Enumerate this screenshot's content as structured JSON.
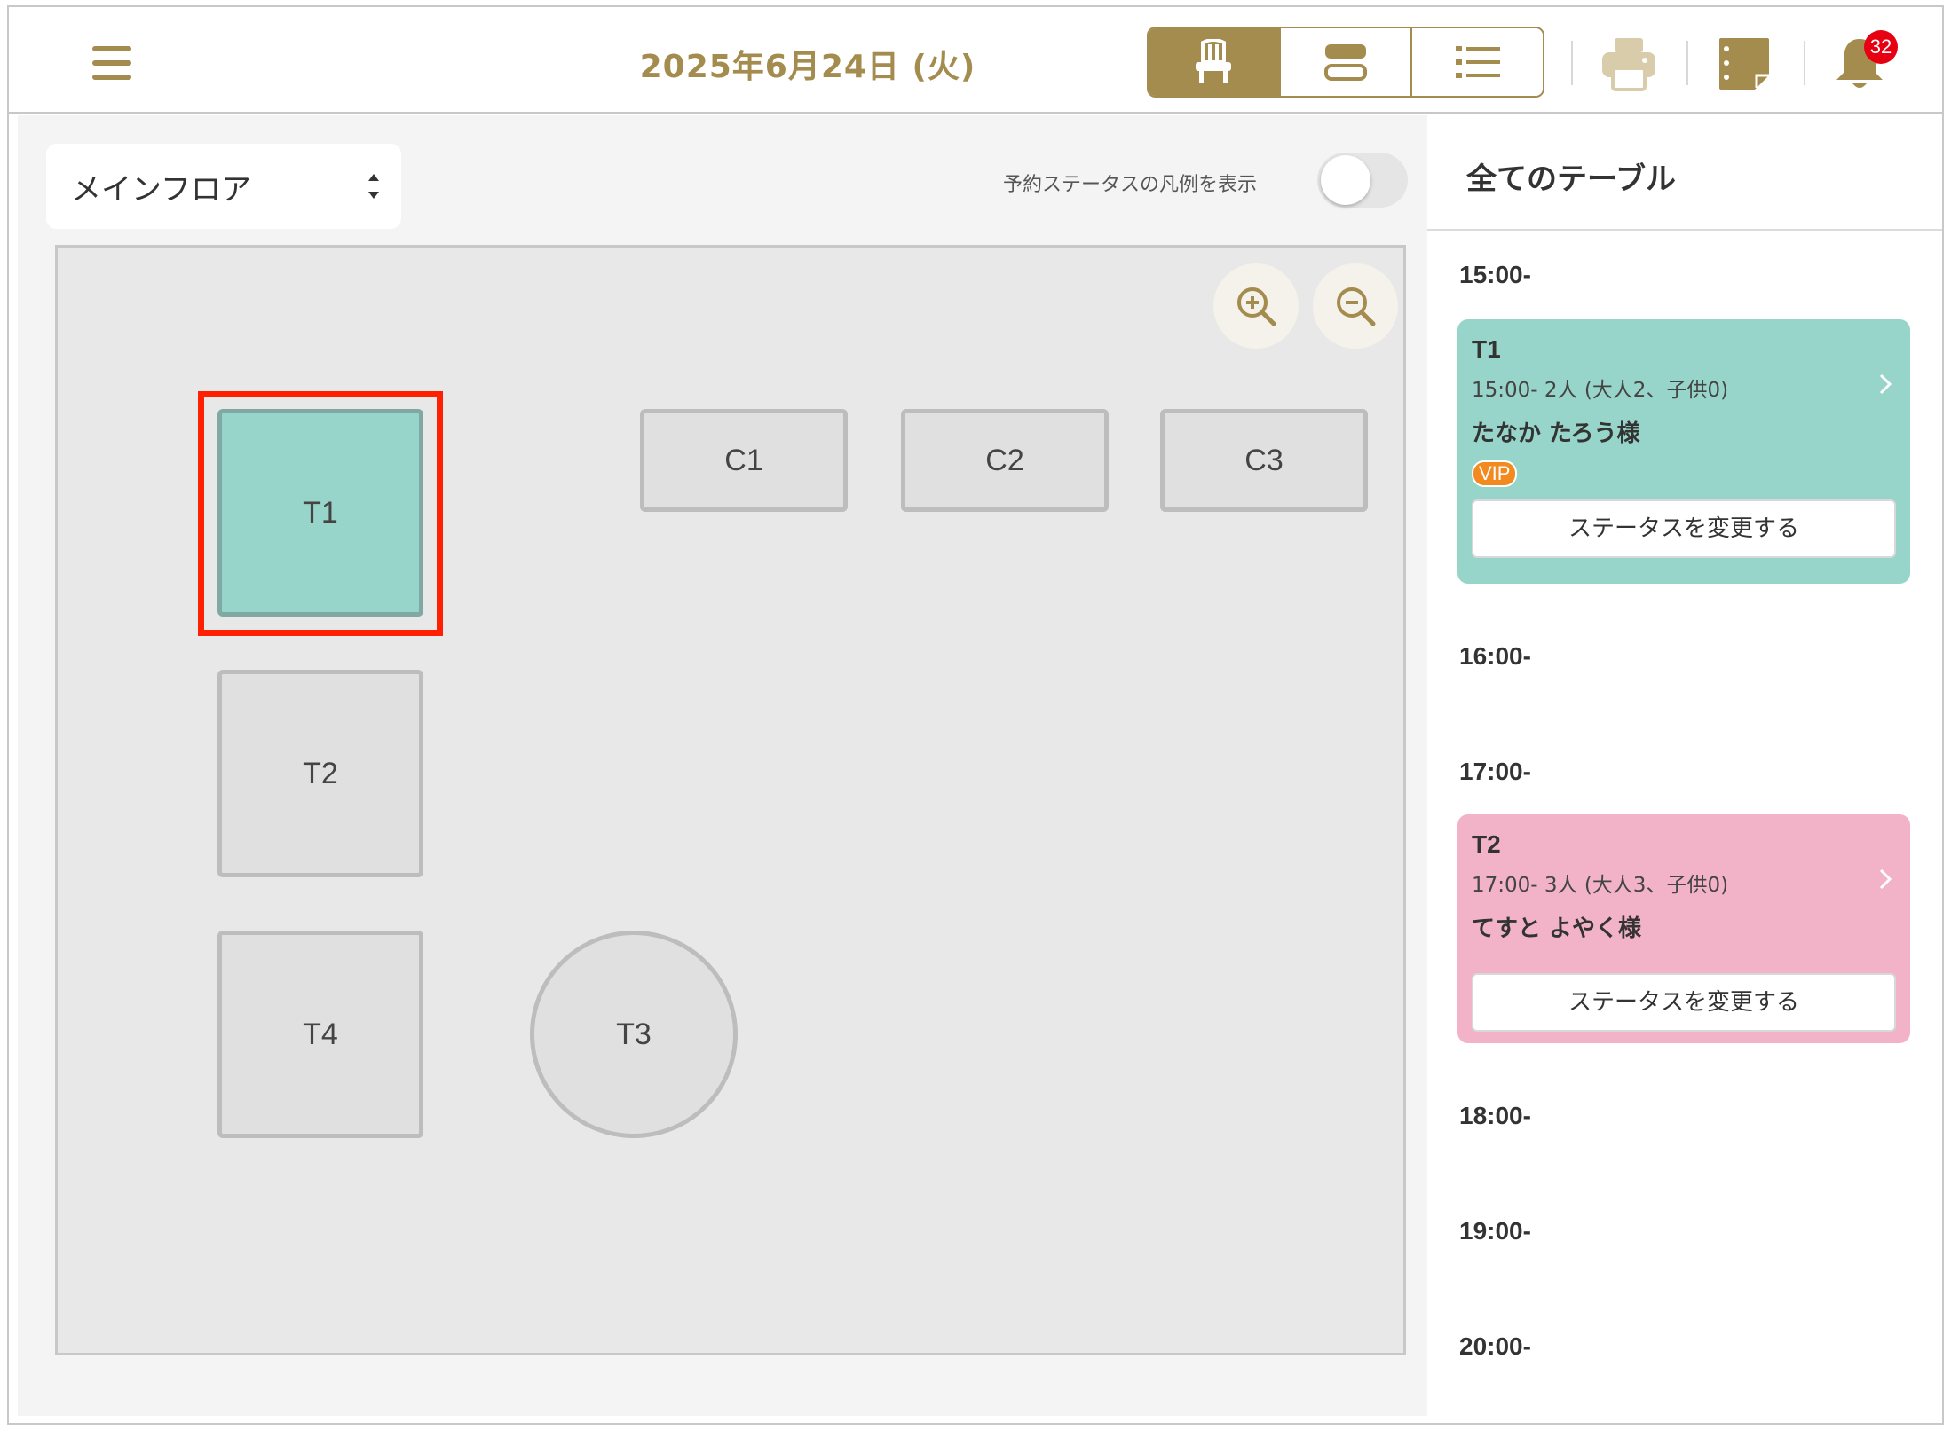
{
  "header": {
    "date": "2025年6月24日 (火)",
    "notifications_count": "32",
    "accent_color": "#a48c4f",
    "view_modes": [
      "chair-icon",
      "timeline-rows-icon",
      "list-icon"
    ],
    "active_view": "chair-icon"
  },
  "floor": {
    "selected": "メインフロア",
    "legend_toggle_label": "予約ステータスの凡例を表示",
    "legend_toggle_on": false,
    "tables": [
      {
        "id": "T1",
        "label": "T1",
        "shape": "square",
        "status": "occupied",
        "selected": true
      },
      {
        "id": "C1",
        "label": "C1",
        "shape": "rect",
        "status": "empty"
      },
      {
        "id": "C2",
        "label": "C2",
        "shape": "rect",
        "status": "empty"
      },
      {
        "id": "C3",
        "label": "C3",
        "shape": "rect",
        "status": "empty"
      },
      {
        "id": "T2",
        "label": "T2",
        "shape": "square",
        "status": "empty"
      },
      {
        "id": "T4",
        "label": "T4",
        "shape": "square",
        "status": "empty"
      },
      {
        "id": "T3",
        "label": "T3",
        "shape": "round",
        "status": "empty"
      }
    ]
  },
  "side": {
    "title": "全てのテーブル",
    "times": [
      "15:00-",
      "16:00-",
      "17:00-",
      "18:00-",
      "19:00-",
      "20:00-"
    ],
    "reservations": [
      {
        "table": "T1",
        "info": "15:00-  2人 (大人2、子供0)",
        "guest": "たなか たろう様",
        "tag": "VIP",
        "status_button": "ステータスを変更する",
        "color": "#97d4c9"
      },
      {
        "table": "T2",
        "info": "17:00-  3人 (大人3、子供0)",
        "guest": "てすと よやく様",
        "status_button": "ステータスを変更する",
        "color": "#f2b2c8"
      }
    ]
  }
}
